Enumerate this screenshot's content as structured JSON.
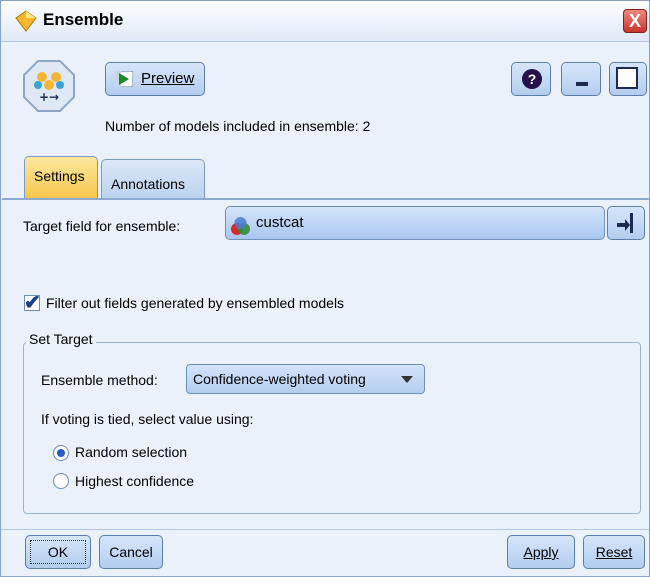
{
  "window": {
    "title": "Ensemble",
    "close_label": "X"
  },
  "toolbar": {
    "preview_label": "Preview",
    "help_label": "?"
  },
  "info": {
    "models_text": "Number of models included in ensemble: 2"
  },
  "tabs": [
    {
      "label": "Settings",
      "active": true
    },
    {
      "label": "Annotations",
      "active": false
    }
  ],
  "settings": {
    "target_label": "Target field for ensemble:",
    "target_value": "custcat",
    "filter_label": "Filter out fields generated by ensembled models",
    "filter_checked": true,
    "set_target_legend": "Set Target",
    "method_label": "Ensemble method:",
    "method_value": "Confidence-weighted voting",
    "tie_label": "If voting is tied, select value using:",
    "radio_random": "Random selection",
    "radio_highest": "Highest confidence",
    "selected_radio": "Random selection"
  },
  "buttons": {
    "ok": "OK",
    "cancel": "Cancel",
    "apply": "Apply",
    "reset": "Reset"
  },
  "icons": {
    "title": "ensemble-diamond-icon",
    "node": "ensemble-node-icon",
    "preview": "preview-play-icon",
    "field": "set-field-icon",
    "field_picker": "field-picker-icon"
  },
  "colors": {
    "window_bg": "#eaf1fb",
    "active_tab": "#f5c74c",
    "button": "#b3cdef",
    "radio_dot": "#2459c7"
  }
}
